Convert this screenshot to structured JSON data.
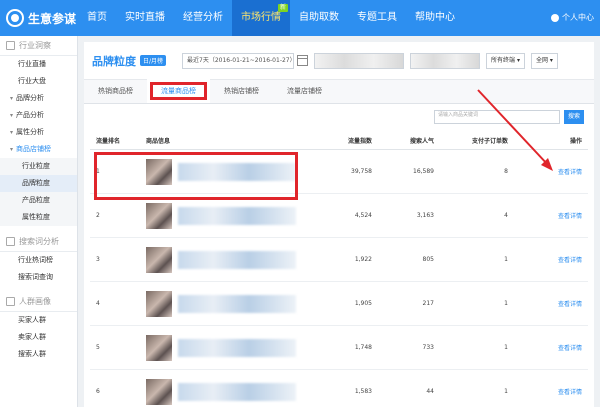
{
  "app": {
    "title": "生意参谋"
  },
  "nav": {
    "items": [
      {
        "label": "首页"
      },
      {
        "label": "实时直播"
      },
      {
        "label": "经营分析"
      },
      {
        "label": "市场行情",
        "active": true,
        "badge": "新"
      },
      {
        "label": "自助取数"
      },
      {
        "label": "专题工具"
      },
      {
        "label": "帮助中心"
      }
    ],
    "user_label": "个人中心"
  },
  "sidebar": {
    "sections": [
      {
        "head": "行业洞察",
        "items": [
          {
            "label": "行业直播",
            "kind": "item"
          },
          {
            "label": "行业大盘",
            "kind": "item"
          },
          {
            "label": "品牌分析",
            "kind": "group"
          },
          {
            "label": "产品分析",
            "kind": "group"
          },
          {
            "label": "属性分析",
            "kind": "group"
          },
          {
            "label": "商品店铺榜",
            "kind": "group",
            "expanded": true
          },
          {
            "label": "行业粒度",
            "kind": "sub"
          },
          {
            "label": "品牌粒度",
            "kind": "sub",
            "current": true
          },
          {
            "label": "产品粒度",
            "kind": "sub"
          },
          {
            "label": "属性粒度",
            "kind": "sub"
          }
        ]
      },
      {
        "head": "搜索词分析",
        "items": [
          {
            "label": "行业热词榜",
            "kind": "item"
          },
          {
            "label": "搜索词查询",
            "kind": "item"
          }
        ]
      },
      {
        "head": "人群画像",
        "items": [
          {
            "label": "买家人群",
            "kind": "item"
          },
          {
            "label": "卖家人群",
            "kind": "item"
          },
          {
            "label": "搜索人群",
            "kind": "item"
          }
        ]
      }
    ]
  },
  "page": {
    "title": "品牌粒度",
    "tag": "日/月榜",
    "date_range": "最近7天（2016-01-21~2016-01-27）",
    "terminal_select": "所有终端",
    "region_select": "全网"
  },
  "tabs": [
    {
      "label": "热销商品榜"
    },
    {
      "label": "流量商品榜",
      "active": true
    },
    {
      "label": "热销店铺榜"
    },
    {
      "label": "流量店铺榜"
    }
  ],
  "search": {
    "placeholder": "请输入商品关键词",
    "button": "搜索"
  },
  "table": {
    "headers": [
      "流量排名",
      "商品信息",
      "流量指数",
      "搜索人气",
      "支付子订单数",
      "操作"
    ],
    "rows": [
      {
        "rank": "1",
        "traffic": "39,758",
        "search": "16,589",
        "orders": "8",
        "op": "查看详情"
      },
      {
        "rank": "2",
        "traffic": "4,524",
        "search": "3,163",
        "orders": "4",
        "op": "查看详情"
      },
      {
        "rank": "3",
        "traffic": "1,922",
        "search": "805",
        "orders": "1",
        "op": "查看详情"
      },
      {
        "rank": "4",
        "traffic": "1,905",
        "search": "217",
        "orders": "1",
        "op": "查看详情"
      },
      {
        "rank": "5",
        "traffic": "1,748",
        "search": "733",
        "orders": "1",
        "op": "查看详情"
      },
      {
        "rank": "6",
        "traffic": "1,583",
        "search": "44",
        "orders": "1",
        "op": "查看详情"
      }
    ]
  },
  "colors": {
    "primary": "#2d8ff0",
    "highlight": "#e0252b",
    "active_nav_text": "#ffe66b"
  },
  "icons": {
    "logo": "logo-icon",
    "user": "user-icon",
    "calendar": "calendar-icon"
  }
}
